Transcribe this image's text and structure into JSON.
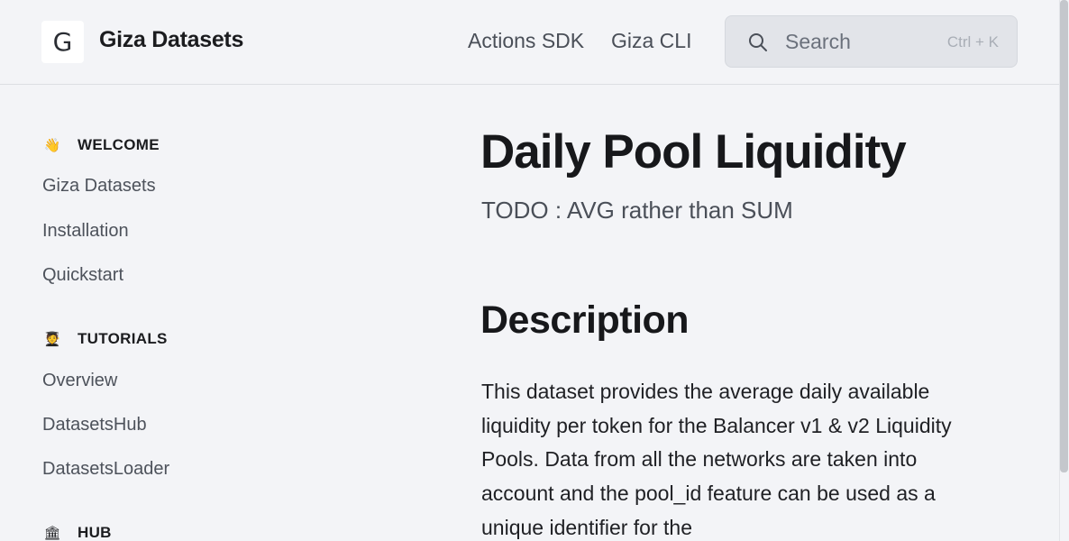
{
  "header": {
    "logo_letter": "G",
    "brand": "Giza Datasets",
    "nav": [
      {
        "label": "Actions SDK"
      },
      {
        "label": "Giza CLI"
      }
    ],
    "search": {
      "label": "Search",
      "shortcut": "Ctrl + K"
    }
  },
  "sidebar": {
    "sections": [
      {
        "emoji": "👋",
        "label": "WELCOME",
        "items": [
          "Giza Datasets",
          "Installation",
          "Quickstart"
        ]
      },
      {
        "emoji": "🧑‍🎓",
        "label": "TUTORIALS",
        "items": [
          "Overview",
          "DatasetsHub",
          "DatasetsLoader"
        ]
      },
      {
        "emoji": "🏛",
        "label": "HUB",
        "items": []
      }
    ]
  },
  "main": {
    "title": "Daily Pool Liquidity",
    "subtitle": "TODO : AVG rather than SUM",
    "description_heading": "Description",
    "description": "This dataset provides the average daily available liquidity per token for the Balancer v1 & v2 Liquidity Pools. Data from all the networks are taken into account and the pool_id feature can be used as a unique identifier for the"
  },
  "colors": {
    "background": "#f3f4f7",
    "text": "#1b1c1f",
    "muted": "#4d525b"
  }
}
